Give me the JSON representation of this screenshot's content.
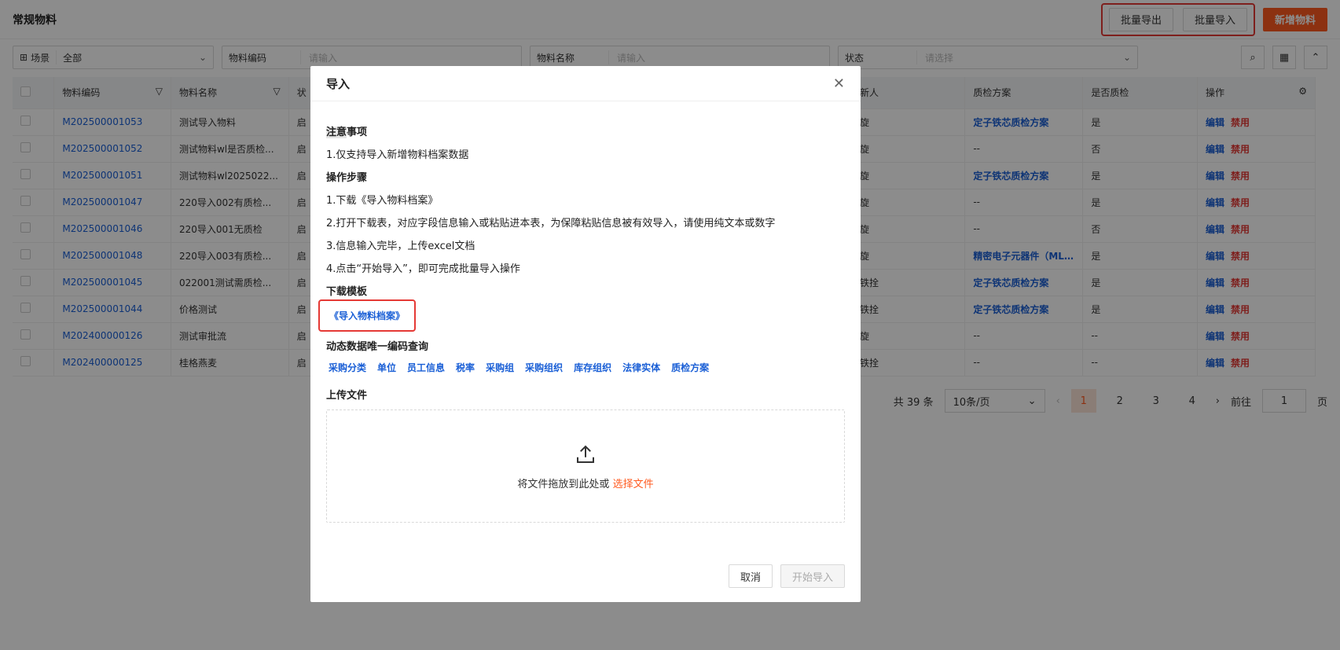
{
  "header": {
    "title": "常规物料",
    "export_label": "批量导出",
    "import_label": "批量导入",
    "add_label": "新增物料"
  },
  "filters": {
    "scene_label": "场景",
    "scene_value": "全部",
    "code_label": "物料编码",
    "code_placeholder": "请输入",
    "name_label": "物料名称",
    "name_placeholder": "请输入",
    "status_label": "状态",
    "status_placeholder": "请选择"
  },
  "table": {
    "headers": [
      "物料编码",
      "物料名称",
      "状",
      "新人",
      "质检方案",
      "是否质检",
      "操作"
    ],
    "rows": [
      {
        "code": "M202500001053",
        "name": "测试导入物料",
        "status": "启",
        "creator": "旋",
        "plan": "定子铁芯质检方案",
        "qc": "是"
      },
      {
        "code": "M202500001052",
        "name": "测试物料wl是否质检...",
        "status": "启",
        "creator": "旋",
        "plan": "--",
        "qc": "否"
      },
      {
        "code": "M202500001051",
        "name": "测试物料wl2025022...",
        "status": "启",
        "creator": "旋",
        "plan": "定子铁芯质检方案",
        "qc": "是"
      },
      {
        "code": "M202500001047",
        "name": "220导入002有质检...",
        "status": "启",
        "creator": "旋",
        "plan": "--",
        "qc": "是"
      },
      {
        "code": "M202500001046",
        "name": "220导入001无质检",
        "status": "启",
        "creator": "旋",
        "plan": "--",
        "qc": "否"
      },
      {
        "code": "M202500001048",
        "name": "220导入003有质检...",
        "status": "启",
        "creator": "旋",
        "plan": "精密电子元器件（MLCC",
        "qc": "是"
      },
      {
        "code": "M202500001045",
        "name": "022001测试需质检...",
        "status": "启",
        "creator": "铁拴",
        "plan": "定子铁芯质检方案",
        "qc": "是"
      },
      {
        "code": "M202500001044",
        "name": "价格测试",
        "status": "启",
        "creator": "铁拴",
        "plan": "定子铁芯质检方案",
        "qc": "是"
      },
      {
        "code": "M202400000126",
        "name": "测试审批流",
        "status": "启",
        "creator": "旋",
        "plan": "--",
        "qc": "--"
      },
      {
        "code": "M202400000125",
        "name": "桂格燕麦",
        "status": "启",
        "creator": "铁拴",
        "plan": "--",
        "qc": "--"
      }
    ],
    "edit_label": "编辑",
    "disable_label": "禁用"
  },
  "pager": {
    "total": "共 39 条",
    "size": "10条/页",
    "pages": [
      "1",
      "2",
      "3",
      "4"
    ],
    "goto_label": "前往",
    "goto_value": "1",
    "page_unit": "页"
  },
  "modal": {
    "title": "导入",
    "notice_title_hl": "注意",
    "notice_title_rest": "事项",
    "notice_1": "1.仅支持导入新增物料档案数据",
    "steps_title": "操作步骤",
    "step_1": "1.下载《导入物料档案》",
    "step_2": "2.打开下载表，对应字段信息输入或粘贴进本表，为保障粘贴信息被有效导入，请使用纯文本或数字",
    "step_3": "3.信息输入完毕，上传excel文档",
    "step_4": "4.点击“开始导入”，即可完成批量导入操作",
    "template_title": "下载模板",
    "template_link": "《导入物料档案》",
    "query_title": "动态数据唯一编码查询",
    "query_links": [
      "采购分类",
      "单位",
      "员工信息",
      "税率",
      "采购组",
      "采购组织",
      "库存组织",
      "法律实体",
      "质检方案"
    ],
    "upload_title": "上传文件",
    "upload_text": "将文件拖放到此处或",
    "upload_link": "选择文件",
    "cancel_label": "取消",
    "start_label": "开始导入"
  },
  "colors": {
    "accent": "#ff5a1f",
    "link": "#1a5fd6",
    "danger": "#e53935"
  }
}
